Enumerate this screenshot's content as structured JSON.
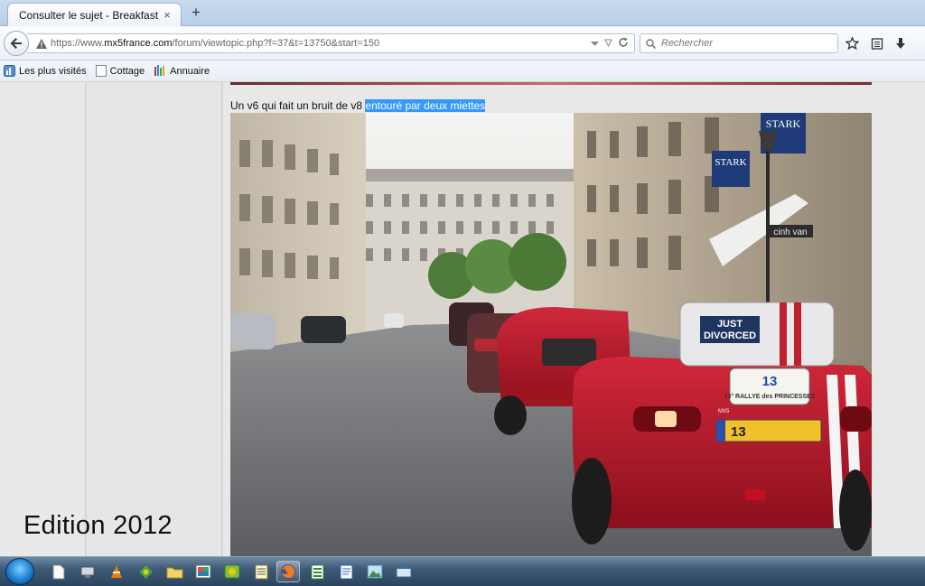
{
  "browser": {
    "tab_title": "Consulter le sujet - Breakfast in...",
    "close_glyph": "×",
    "newtab_glyph": "+",
    "url_prefix": "https://www.",
    "url_domain": "mx5france.com",
    "url_path": "/forum/viewtopic.php?f=37&t=13750&start=150",
    "search_placeholder": "Rechercher"
  },
  "bookmarks": [
    {
      "label": "Les plus visités",
      "icon": "most-visited-icon"
    },
    {
      "label": "Cottage",
      "icon": "page-icon"
    },
    {
      "label": "Annuaire",
      "icon": "directory-icon"
    }
  ],
  "post": {
    "text_plain": "Un v6 qui fait un bruit de v8 ",
    "text_selected": "entouré par deux miettes"
  },
  "photo": {
    "sign_just": "JUST",
    "sign_divorced": "DIVORCED",
    "rally_number": "13",
    "rally_text": "13° RALLYE des PRINCESSES",
    "plate": "13",
    "badge": "MX5",
    "shop_left": "STARK",
    "shop_right": "STARK",
    "awning": "cinh van"
  },
  "watermark": "Edition 2012",
  "taskbar": {
    "icons": [
      "start-orb",
      "document-icon",
      "network-icon",
      "vlc-icon",
      "app-icon",
      "folder-icon",
      "paint-icon",
      "media-icon",
      "notepad-icon",
      "firefox-icon",
      "spreadsheet-icon",
      "writer-icon",
      "photo-icon",
      "explorer-icon"
    ]
  }
}
